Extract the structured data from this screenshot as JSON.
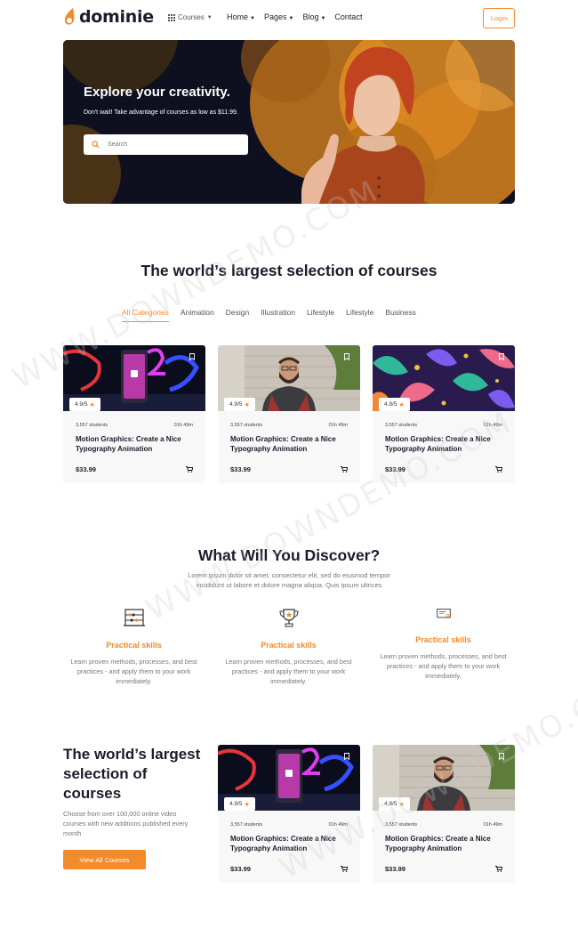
{
  "nav": {
    "logo_text": "dominie",
    "courses_label": "Courses",
    "menu": [
      {
        "label": "Home",
        "caret": true
      },
      {
        "label": "Pages",
        "caret": true
      },
      {
        "label": "Blog",
        "caret": true
      },
      {
        "label": "Contact",
        "caret": false
      }
    ],
    "login_label": "Login"
  },
  "hero": {
    "title": "Explore your creativity.",
    "subtitle": "Don't wait! Take advantage of courses as low as $11.99.",
    "search_placeholder": "Search"
  },
  "selection": {
    "title": "The world’s largest selection of courses",
    "tabs": [
      "All Categories",
      "Animation",
      "Design",
      "Illustration",
      "Lifestyle",
      "Lifestyle",
      "Business"
    ],
    "active_tab": 0
  },
  "courses": [
    {
      "rating": "4.9/5",
      "students": "3,557 students",
      "time": "01h 49m",
      "title": "Motion Graphics: Create a Nice Typography Animation",
      "price": "$33.99",
      "thumb": "phone"
    },
    {
      "rating": "4.9/5",
      "students": "3,557 students",
      "time": "01h 49m",
      "title": "Motion Graphics: Create a Nice Typography Animation",
      "price": "$33.99",
      "thumb": "man"
    },
    {
      "rating": "4.9/5",
      "students": "3,557 students",
      "time": "01h 49m",
      "title": "Motion Graphics: Create a Nice Typography Animation",
      "price": "$33.99",
      "thumb": "leaves"
    }
  ],
  "discover": {
    "title": "What Will You Discover?",
    "subtitle": "Lorem ipsum dolor sit amet, consectetur elit, sed do eiusmod tempor incididunt ut labore et dolore magna aliqua. Quis ipsum ultrices",
    "features": [
      {
        "icon": "abacus-icon",
        "title": "Practical skills",
        "desc": "Learn proven methods, processes, and best practices - and apply them to your work immediately."
      },
      {
        "icon": "trophy-icon",
        "title": "Practical skills",
        "desc": "Learn proven methods, processes, and best practices - and apply them to your work immediately."
      },
      {
        "icon": "certificate-icon",
        "title": "Practical skills",
        "desc": "Learn proven methods, processes, and best practices - and apply them to your work immediately."
      }
    ]
  },
  "promo": {
    "title": "The world’s largest selection of courses",
    "subtitle": "Choose from over 100,000 online video courses with new additions published every month",
    "button_label": "View All Courses"
  },
  "promo_courses": [
    {
      "rating": "4.9/5",
      "students": "3,557 students",
      "time": "01h 49m",
      "title": "Motion Graphics: Create a Nice Typography Animation",
      "price": "$33.99",
      "thumb": "phone"
    },
    {
      "rating": "4.9/5",
      "students": "3,557 students",
      "time": "01h 49m",
      "title": "Motion Graphics: Create a Nice Typography Animation",
      "price": "$33.99",
      "thumb": "man"
    }
  ],
  "watermark": "WWW.DOWNDEMO.COM",
  "colors": {
    "accent": "#f18b2c",
    "dark": "#1a1d2b",
    "muted": "#777777"
  }
}
